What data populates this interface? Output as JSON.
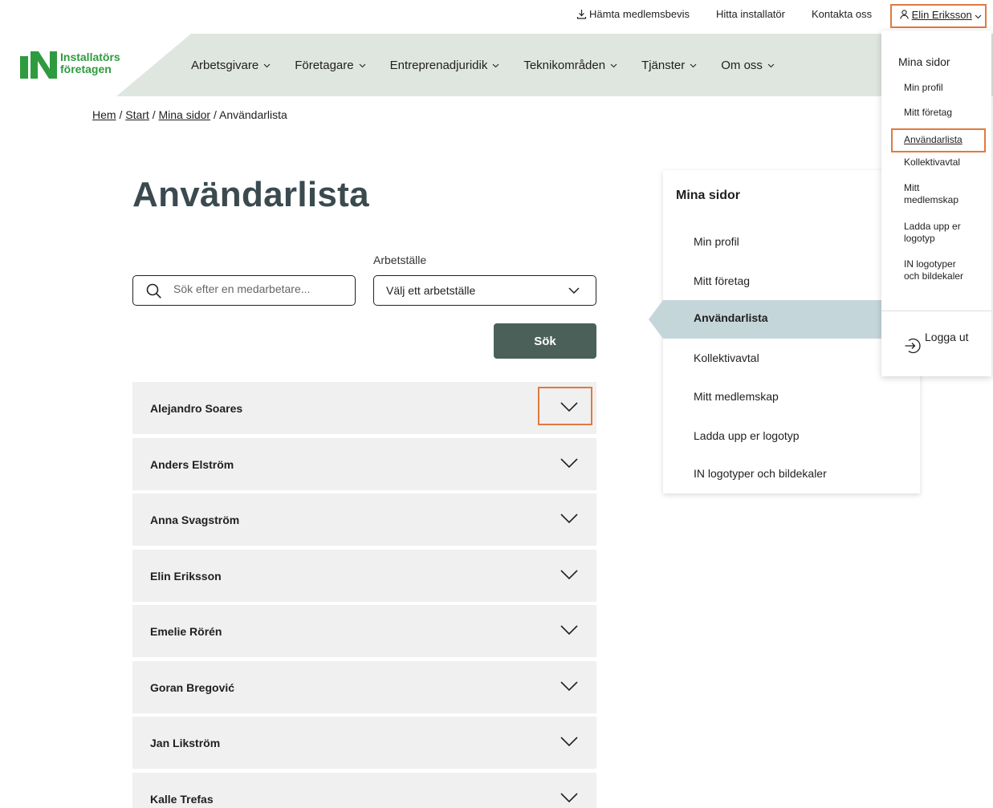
{
  "utility_bar": {
    "membership_proof": "Hämta medlemsbevis",
    "find_installer": "Hitta installatör",
    "contact": "Kontakta oss",
    "user_name": "Elin Eriksson"
  },
  "logo": {
    "line1": "Installatörs",
    "line2": "företagen",
    "mark": "IN"
  },
  "nav": {
    "items": [
      {
        "label": "Arbetsgivare"
      },
      {
        "label": "Företagare"
      },
      {
        "label": "Entreprenadjuridik"
      },
      {
        "label": "Teknikområden"
      },
      {
        "label": "Tjänster"
      },
      {
        "label": "Om oss"
      }
    ]
  },
  "breadcrumb": {
    "home": "Hem",
    "start": "Start",
    "my_pages": "Mina sidor",
    "current": "Användarlista",
    "separator": "/"
  },
  "page_title": "Användarlista",
  "search": {
    "placeholder": "Sök efter en medarbetare...",
    "workplace_label": "Arbetställe",
    "workplace_selected": "Välj ett arbetställe",
    "button_label": "Sök"
  },
  "users": [
    {
      "name": "Alejandro Soares"
    },
    {
      "name": "Anders Elström"
    },
    {
      "name": "Anna Svagström"
    },
    {
      "name": "Elin Eriksson"
    },
    {
      "name": "Emelie Rörén"
    },
    {
      "name": "Goran Bregović"
    },
    {
      "name": "Jan Likström"
    },
    {
      "name": "Kalle Trefas"
    }
  ],
  "side_menu": {
    "title": "Mina sidor",
    "items": [
      {
        "label": "Min profil"
      },
      {
        "label": "Mitt företag"
      },
      {
        "label": "Användarlista"
      },
      {
        "label": "Kollektivavtal"
      },
      {
        "label": "Mitt medlemskap"
      },
      {
        "label": "Ladda upp er logotyp"
      },
      {
        "label": "IN logotyper och bildekaler"
      }
    ]
  },
  "dropdown": {
    "title": "Mina sidor",
    "items": [
      {
        "label": "Min profil"
      },
      {
        "label": "Mitt företag"
      },
      {
        "label": "Användarlista"
      },
      {
        "label": "Kollektivavtal"
      },
      {
        "label": "Mitt medlemskap"
      },
      {
        "label": "Ladda upp er logotyp"
      },
      {
        "label": "IN logotyper och bildekaler"
      }
    ],
    "logout": "Logga ut"
  },
  "colors": {
    "brand_green": "#2e9b3f",
    "header_band": "#dfe6df",
    "active_item": "#c5d6db",
    "button": "#4a6059",
    "highlight": "#e07a3f",
    "row_bg": "#f0f0f0"
  }
}
